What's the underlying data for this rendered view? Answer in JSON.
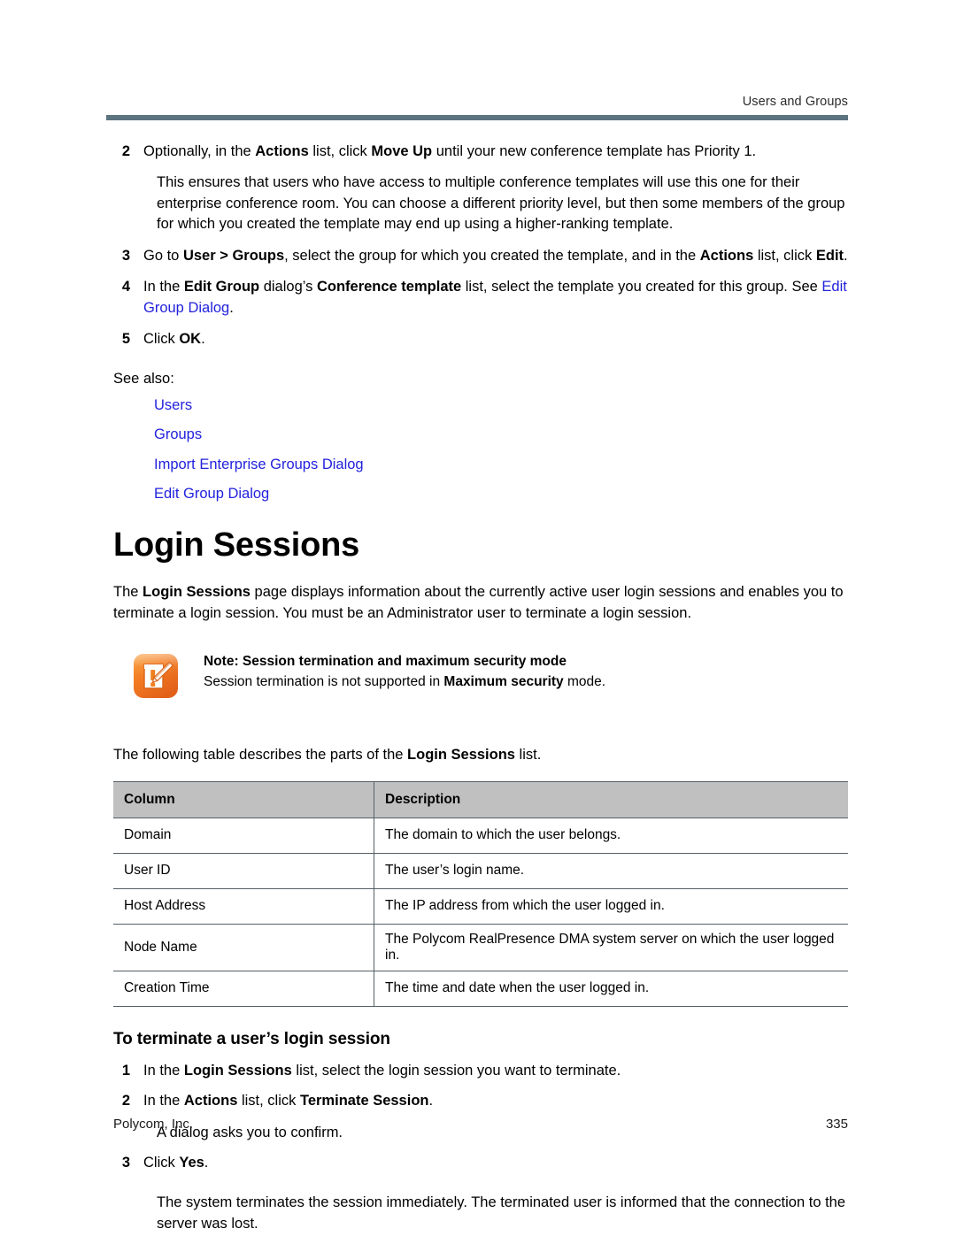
{
  "header": {
    "running_title": "Users and Groups",
    "rule_color": "#5c7380"
  },
  "top_steps": [
    {
      "number": "2",
      "segments": [
        {
          "text": "Optionally, in the ",
          "style": "normal"
        },
        {
          "text": "Actions",
          "style": "bold"
        },
        {
          "text": " list, click ",
          "style": "normal"
        },
        {
          "text": "Move Up",
          "style": "bold"
        },
        {
          "text": " until your new conference template has Priority 1.",
          "style": "normal"
        }
      ],
      "plain": "Optionally, in the Actions list, click Move Up until your new conference template has Priority 1."
    },
    {
      "number": "3",
      "plain": "Go to User > Groups, select the group for which you created the template, and in the Actions list, click Edit."
    },
    {
      "number": "4",
      "plain": "In the Edit Group dialog’s Conference template list, select the template you created for this group. See Edit Group Dialog."
    },
    {
      "number": "5",
      "plain": "Click OK."
    }
  ],
  "step2_continuation": "This ensures that users who have access to multiple conference templates will use this one for their enterprise conference room. You can choose a different priority level, but then some members of the group for which you created the template may end up using a higher-ranking template.",
  "see_also": {
    "label": "See also:",
    "links": [
      "Users",
      "Groups",
      "Import Enterprise Groups Dialog",
      "Edit Group Dialog"
    ],
    "link_color": "#2222dd"
  },
  "section": {
    "title": "Login Sessions",
    "intro": "The Login Sessions page displays information about the currently active user login sessions and enables you to terminate a login session. You must be an Administrator user to terminate a login session."
  },
  "note": {
    "icon": "note-pencil-icon",
    "icon_color": "#f07b28",
    "title": "Note: Session termination and maximum security mode",
    "text": "Session termination is not supported in Maximum security mode."
  },
  "table": {
    "lead_in": "The following table describes the parts of the Login Sessions list.",
    "header_bg": "#c0c0c0",
    "columns": [
      "Column",
      "Description"
    ],
    "rows": [
      [
        "Domain",
        "The domain to which the user belongs."
      ],
      [
        "User ID",
        "The user’s login name."
      ],
      [
        "Host Address",
        "The IP address from which the user logged in."
      ],
      [
        "Node Name",
        "The Polycom RealPresence DMA system server on which the user logged in."
      ],
      [
        "Creation Time",
        "The time and date when the user logged in."
      ]
    ]
  },
  "procedure": {
    "title": "To terminate a user’s login session",
    "steps": [
      {
        "number": "1",
        "plain": "In the Login Sessions list, select the login session you want to terminate."
      },
      {
        "number": "2",
        "plain": "In the Actions list, click Terminate Session."
      },
      {
        "number": "3",
        "plain": "Click Yes."
      }
    ],
    "after_step2": "A dialog asks you to confirm.",
    "closing": "The system terminates the session immediately. The terminated user is informed that the connection to the server was lost."
  },
  "footer": {
    "company": "Polycom, Inc.",
    "page_number": "335"
  }
}
